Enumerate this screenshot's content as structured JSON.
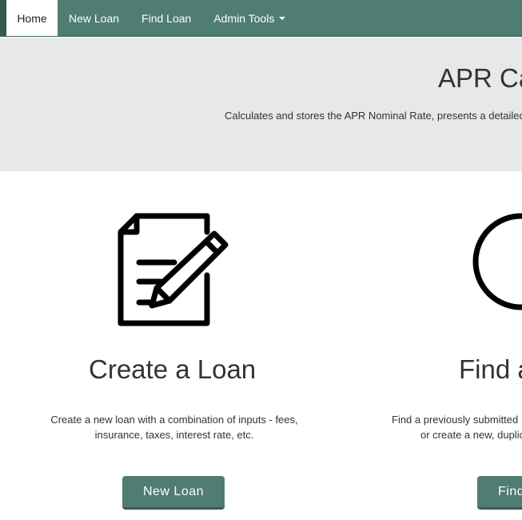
{
  "nav": {
    "home": "Home",
    "new_loan": "New Loan",
    "find_loan": "Find Loan",
    "admin_tools": "Admin Tools"
  },
  "hero": {
    "title": "APR Ca",
    "subtitle": "Calculates and stores the APR Nominal Rate, presents a detailed"
  },
  "cards": {
    "create": {
      "icon": "document-pencil-icon",
      "title": "Create a Loan",
      "desc_line1": "Create a new loan with a combination of inputs - fees,",
      "desc_line2": "insurance, taxes, interest rate, etc.",
      "button": "New Loan"
    },
    "find": {
      "icon": "magnifier-icon",
      "title": "Find a",
      "desc_line1": "Find a previously submitted",
      "desc_line2": "or create a new, duplic",
      "button": "Find"
    }
  },
  "colors": {
    "navbar": "#4f7d73",
    "button": "#4f7d73",
    "jumbotron": "#e8e8e8"
  }
}
